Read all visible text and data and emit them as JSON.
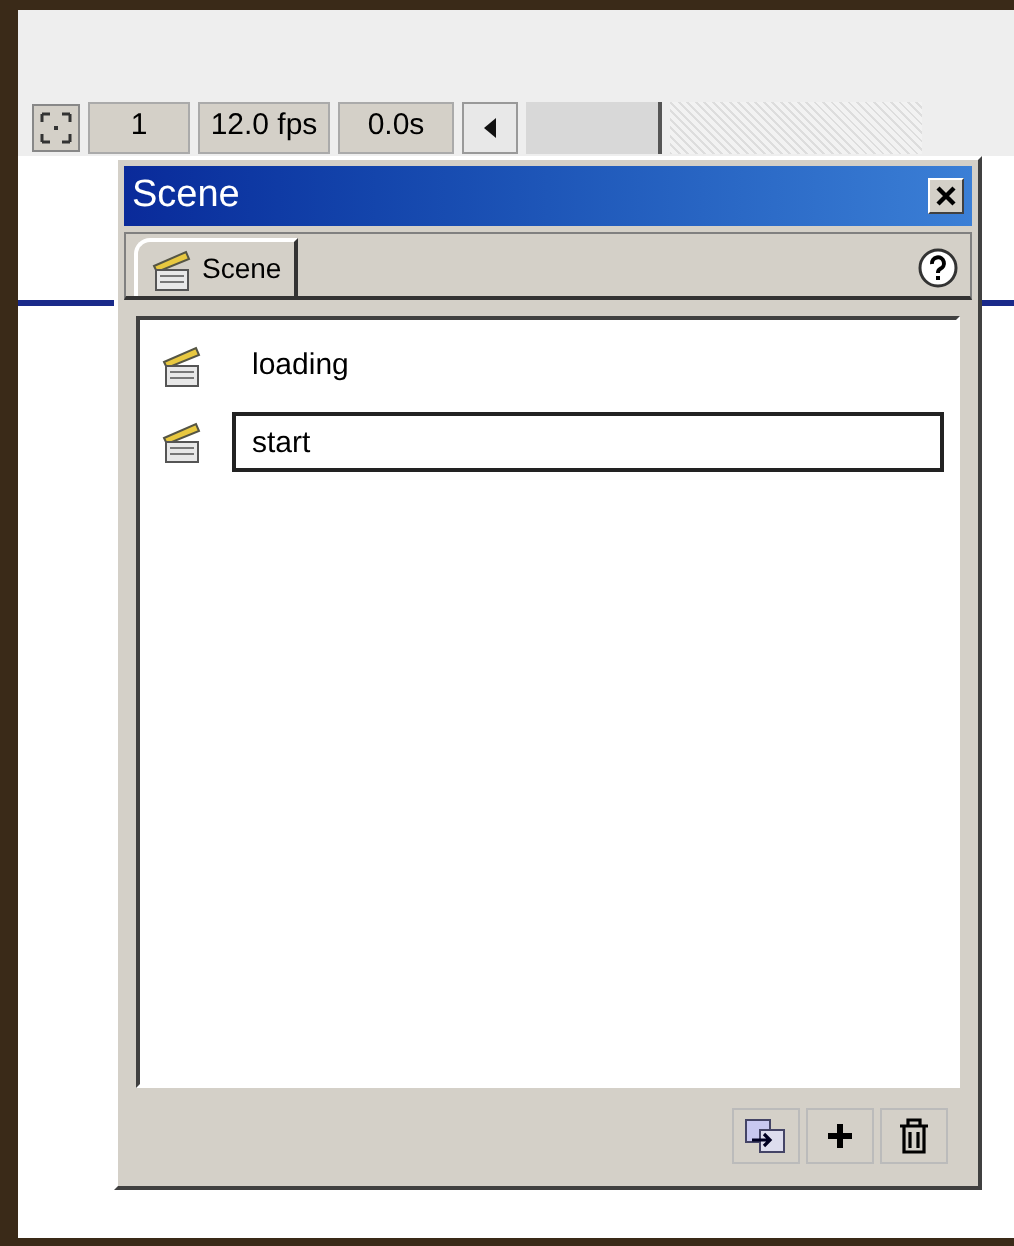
{
  "timeline_toolbar": {
    "frame": "1",
    "frame_rate": "12.0 fps",
    "elapsed_time": "0.0s"
  },
  "panel": {
    "title": "Scene",
    "tab": {
      "label": "Scene",
      "selected": true
    },
    "scenes": [
      {
        "name": "loading",
        "editing": false
      },
      {
        "name": "start",
        "editing": true
      }
    ]
  }
}
